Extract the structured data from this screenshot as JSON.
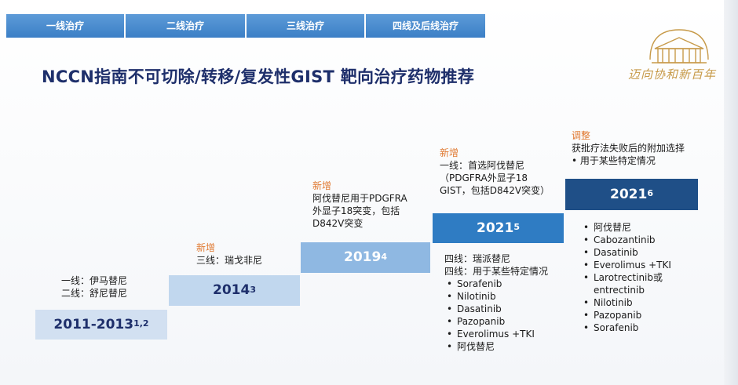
{
  "tabs": [
    {
      "label": "一线治疗"
    },
    {
      "label": "二线治疗"
    },
    {
      "label": "三线治疗"
    },
    {
      "label": "四线及后线治疗"
    }
  ],
  "title": "NCCN指南不可切除/转移/复发性GIST 靶向治疗药物推荐",
  "logo": {
    "caption": "迈向协和新百年",
    "icon": "pumc-building-logo"
  },
  "colors": {
    "tab": "#4a8ccf",
    "title": "#1e2f6b",
    "tag": "#e07a33",
    "darkStep": "#1f4f87"
  },
  "steps": [
    {
      "year": "2011-2013",
      "ref": "1,2"
    },
    {
      "year": "2014",
      "ref": "3"
    },
    {
      "year": "2019",
      "ref": "4"
    },
    {
      "year": "2021",
      "ref": "5"
    },
    {
      "year": "2021",
      "ref": "6"
    }
  ],
  "notes": {
    "n1": {
      "line1": "一线：伊马替尼",
      "line2": "二线：舒尼替尼"
    },
    "n2": {
      "tag": "新增",
      "line1": "三线：瑞戈非尼"
    },
    "n3": {
      "tag": "新增",
      "line1": "阿伐替尼用于PDGFRA",
      "line2": "外显子18突变，包括",
      "line3": "D842V突变"
    },
    "n4": {
      "tag": "新增",
      "line1": "一线：首选阿伐替尼",
      "line2": "（PDGFRA外显子18",
      "line3": "GIST，包括D842V突变）"
    },
    "n5": {
      "tag": "调整",
      "line1": "获批疗法失败后的附加选择",
      "line2": "• 用于某些特定情况"
    },
    "below4": {
      "line1": "四线：瑞派替尼",
      "line2": "四线：用于某些特定情况",
      "items": [
        "Sorafenib",
        "Nilotinib",
        "Dasatinib",
        "Pazopanib",
        "Everolimus +TKI",
        "阿伐替尼"
      ]
    },
    "below5": {
      "items": [
        "阿伐替尼",
        "Cabozantinib",
        "Dasatinib",
        "Everolimus +TKI",
        "Larotrectinib或",
        "entrectinib",
        "Nilotinib",
        "Pazopanib",
        "Sorafenib"
      ]
    }
  }
}
